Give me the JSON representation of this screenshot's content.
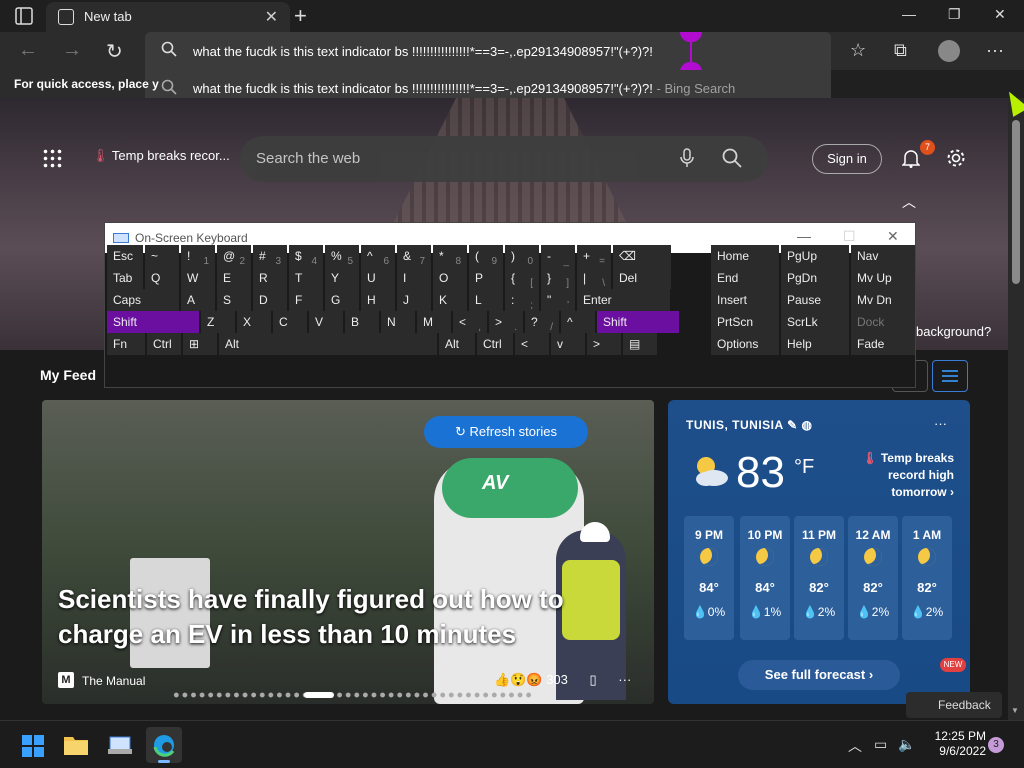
{
  "browser": {
    "tab_title": "New tab",
    "address_text": "what the fucdk is this text indicator bs !!!!!!!!!!!!!!!!*==3=-,.ep29134908957!\"(+?)?!",
    "suggestion_text": "what the fucdk is this text indicator bs !!!!!!!!!!!!!!!!*==3=-,.ep29134908957!\"(+?)?!",
    "suggestion_suffix": " - Bing Search",
    "favorites_hint": "For quick access, place y"
  },
  "hero": {
    "temp_chip": "Temp breaks recor...",
    "search_placeholder": "Search the web",
    "sign_in": "Sign in",
    "notifications_count": "7",
    "background_question": "background?"
  },
  "feed": {
    "title": "My Feed",
    "refresh_label": "Refresh stories",
    "headline": "Scientists have finally figured out how to charge an EV in less than 10 minutes",
    "source_icon": "M",
    "source": "The Manual",
    "reactions_count": "303",
    "charger_logo": "AV"
  },
  "weather": {
    "location": "TUNIS, TUNISIA",
    "temp": "83",
    "unit": "°F",
    "alert": "Temp breaks record high tomorrow",
    "hours": [
      {
        "time": "9 PM",
        "temp": "84°",
        "precip": "💧0%"
      },
      {
        "time": "10 PM",
        "temp": "84°",
        "precip": "💧1%"
      },
      {
        "time": "11 PM",
        "temp": "82°",
        "precip": "💧2%"
      },
      {
        "time": "12 AM",
        "temp": "82°",
        "precip": "💧2%"
      },
      {
        "time": "1 AM",
        "temp": "82°",
        "precip": "💧2%"
      }
    ],
    "forecast_button": "See full forecast",
    "new_badge": "NEW"
  },
  "feedback": "Feedback",
  "osk": {
    "title": "On-Screen Keyboard",
    "rows": [
      [
        "Esc",
        "~",
        "!",
        "@",
        "#",
        "$",
        "%",
        "^",
        "&",
        "*",
        "(",
        ")",
        "-",
        "+",
        "⌫"
      ],
      [
        "Tab",
        "Q",
        "W",
        "E",
        "R",
        "T",
        "Y",
        "U",
        "I",
        "O",
        "P",
        "{",
        "}",
        "|",
        "Del"
      ],
      [
        "Caps",
        "A",
        "S",
        "D",
        "F",
        "G",
        "H",
        "J",
        "K",
        "L",
        ":",
        "\"",
        "Enter"
      ],
      [
        "Shift",
        "Z",
        "X",
        "C",
        "V",
        "B",
        "N",
        "M",
        "<",
        ">",
        "?",
        "^",
        "Shift"
      ],
      [
        "Fn",
        "Ctrl",
        "⊞",
        "Alt",
        "Alt",
        "Ctrl",
        "<",
        "v",
        ">",
        "▤"
      ]
    ],
    "sub": {
      "r0": [
        "",
        "",
        "1",
        "2",
        "3",
        "4",
        "5",
        "6",
        "7",
        "8",
        "9",
        "0",
        "_",
        "=",
        ""
      ],
      "r1": [
        "",
        "",
        "",
        "",
        "",
        "",
        "",
        "",
        "",
        "",
        "",
        "[",
        "]",
        "\\",
        ""
      ],
      "r2": [
        "",
        "",
        "",
        "",
        "",
        "",
        "",
        "",
        "",
        "",
        ";",
        "'",
        ""
      ],
      "r3": [
        "",
        "",
        "",
        "",
        "",
        "",
        "",
        "",
        ",",
        ".",
        "/",
        "",
        ""
      ]
    },
    "right": [
      [
        "Home",
        "PgUp",
        "Nav"
      ],
      [
        "End",
        "PgDn",
        "Mv Up"
      ],
      [
        "Insert",
        "Pause",
        "Mv Dn"
      ],
      [
        "PrtScn",
        "ScrLk",
        "Dock"
      ],
      [
        "Options",
        "Help",
        "Fade"
      ]
    ]
  },
  "taskbar": {
    "time": "12:25 PM",
    "date": "9/6/2022",
    "notifications": "3"
  }
}
